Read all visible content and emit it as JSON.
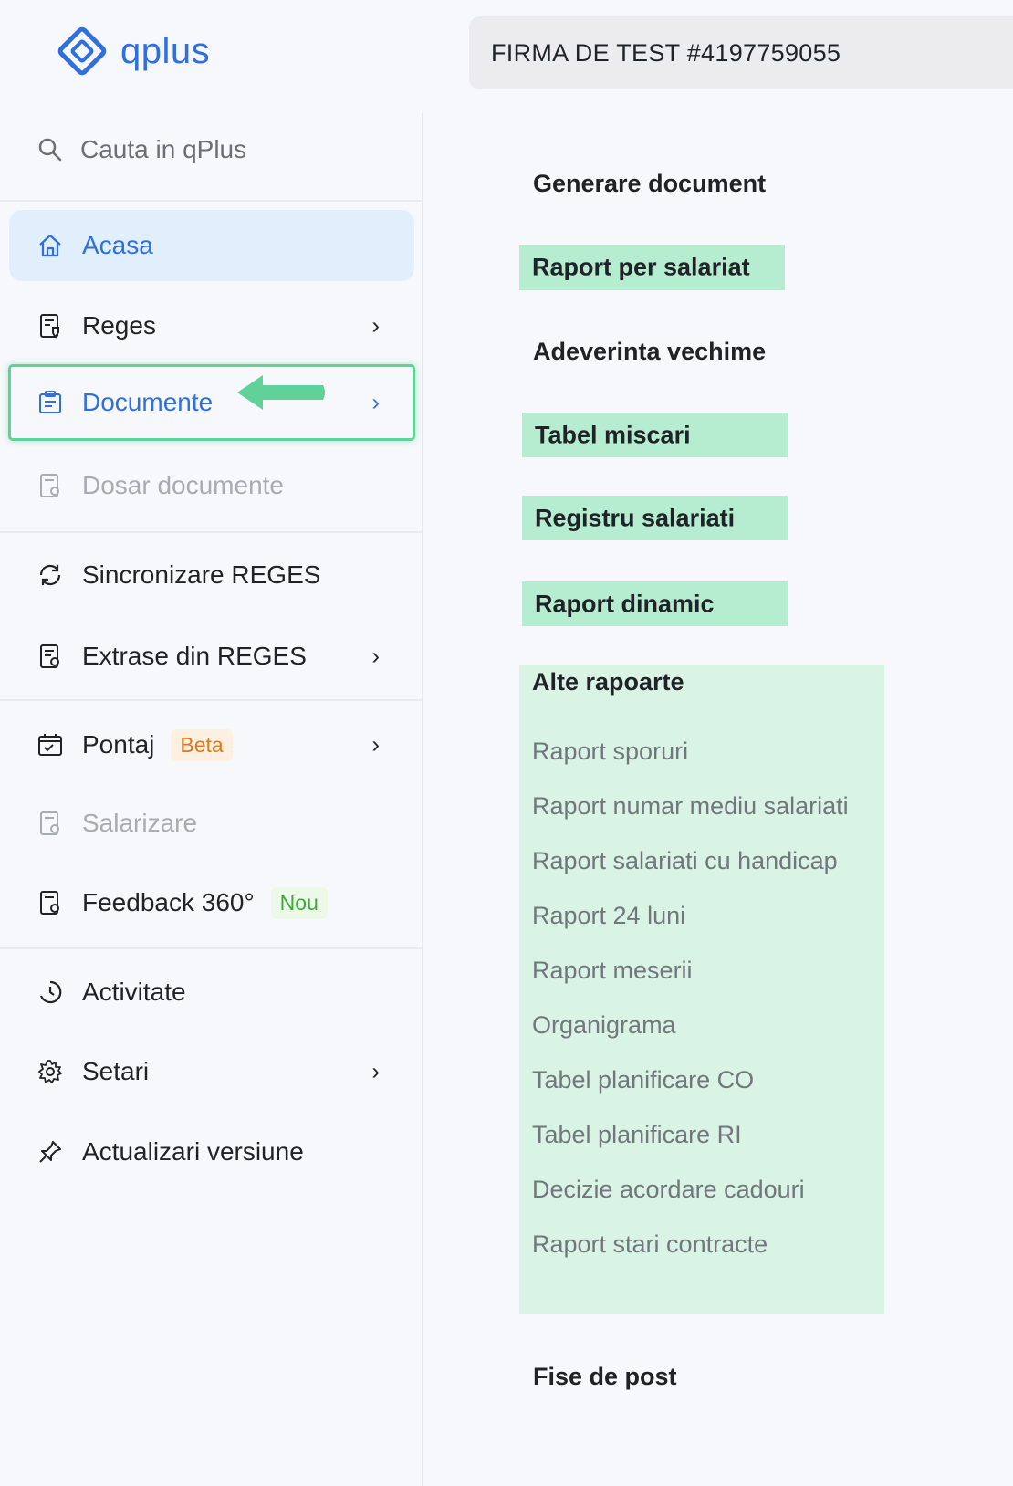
{
  "brand": {
    "name": "qplus",
    "color": "#2f6fde"
  },
  "header": {
    "company": "FIRMA DE TEST #4197759055"
  },
  "search": {
    "placeholder": "Cauta in qPlus",
    "icon": "search-icon"
  },
  "sidebar": {
    "items": [
      {
        "label": "Acasa",
        "icon": "home-icon",
        "state": "active"
      },
      {
        "label": "Reges",
        "icon": "document-shield-icon",
        "chevron": true
      },
      {
        "label": "Documente",
        "icon": "documents-icon",
        "chevron": true,
        "state": "highlighted"
      },
      {
        "label": "Dosar documente",
        "icon": "folder-document-icon",
        "state": "disabled"
      },
      {
        "label": "Sincronizare REGES",
        "icon": "sync-icon"
      },
      {
        "label": "Extrase din REGES",
        "icon": "extract-document-icon",
        "chevron": true
      },
      {
        "label": "Pontaj",
        "icon": "calendar-check-icon",
        "chevron": true,
        "badge": "Beta"
      },
      {
        "label": "Salarizare",
        "icon": "salary-document-icon",
        "state": "disabled"
      },
      {
        "label": "Feedback 360°",
        "icon": "feedback-document-icon",
        "badge": "Nou"
      },
      {
        "label": "Activitate",
        "icon": "clock-history-icon"
      },
      {
        "label": "Setari",
        "icon": "gear-icon",
        "chevron": true
      },
      {
        "label": "Actualizari versiune",
        "icon": "pin-icon"
      }
    ]
  },
  "main": {
    "generare_document": "Generare document",
    "raport_per_salariat": "Raport per salariat",
    "adeverinta_vechime": "Adeverinta vechime",
    "tabel_miscari": "Tabel miscari",
    "registru_salariati": "Registru salariati",
    "raport_dinamic": "Raport dinamic",
    "alte_rapoarte": {
      "title": "Alte rapoarte",
      "items": [
        "Raport sporuri",
        "Raport numar mediu salariati",
        "Raport salariati cu handicap",
        "Raport 24 luni",
        "Raport meserii",
        "Organigrama",
        "Tabel planificare CO",
        "Tabel planificare RI",
        "Decizie acordare cadouri",
        "Raport stari contracte"
      ]
    },
    "fise_de_post": "Fise de post"
  },
  "colors": {
    "highlight_green": "#b6ecd0",
    "active_bg": "#e1eefc",
    "arrow": "#5fd199"
  }
}
